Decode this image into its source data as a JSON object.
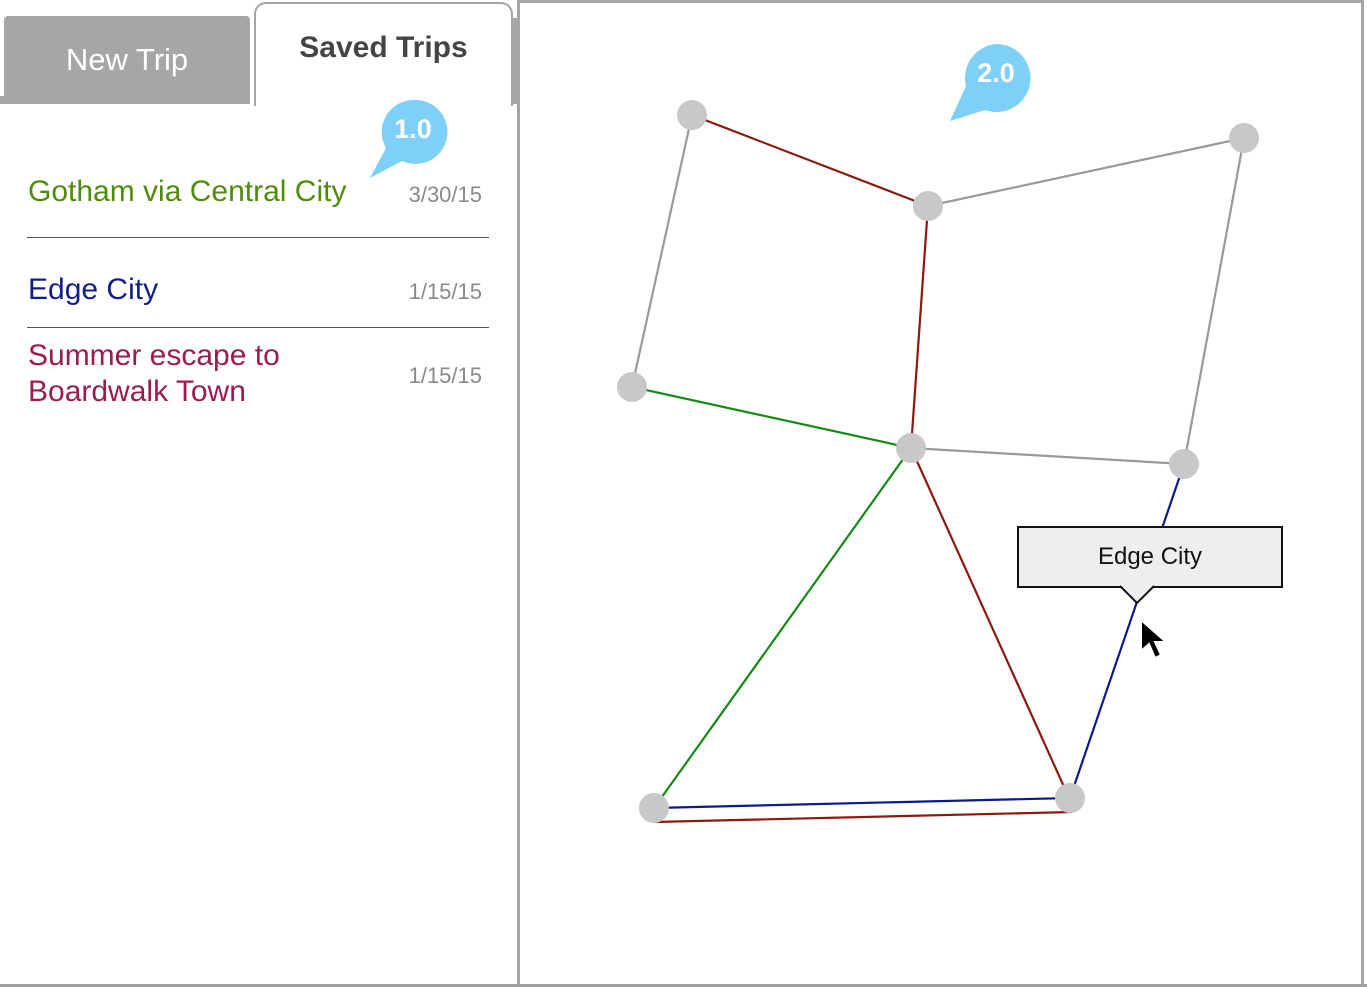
{
  "tabs": [
    {
      "label": "New Trip",
      "active": false
    },
    {
      "label": "Saved Trips",
      "active": true
    }
  ],
  "trips": [
    {
      "name": "Gotham via Central City",
      "date": "3/30/15",
      "color": "#4e8c0a"
    },
    {
      "name": "Edge City",
      "date": "1/15/15",
      "color": "#0f1f8a"
    },
    {
      "name_line1": "Summer escape to",
      "name_line2": "Boardwalk Town",
      "date": "1/15/15",
      "color": "#9a1c50"
    }
  ],
  "annotations": [
    {
      "label": "1.0",
      "color": "#7fd0f8"
    },
    {
      "label": "2.0",
      "color": "#7fd0f8"
    }
  ],
  "map": {
    "tooltip": "Edge City",
    "route_colors": {
      "red": "#8b1a0e",
      "green": "#138a13",
      "blue": "#0b1a8c",
      "gray": "#999999"
    },
    "node_color": "#c8c8c8"
  }
}
